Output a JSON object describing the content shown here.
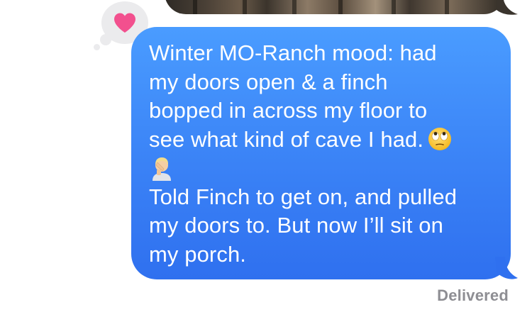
{
  "thread": {
    "tapback": {
      "icon": "heart-icon",
      "color": "#f2508e"
    },
    "message": {
      "line1": "Winter MO-Ranch mood: had",
      "line2": "my doors open & a finch",
      "line3": "bopped in across my floor to",
      "line4": "see what kind of cave I had.",
      "emoji1": "face-with-rolling-eyes-icon",
      "emoji2": "person-facepalming-icon",
      "line5": "Told Finch to get on, and pulled",
      "line6": "my doors to. But now I’ll sit on",
      "line7": "my porch.",
      "bubble_color": "#3a82f6"
    },
    "status": "Delivered"
  }
}
